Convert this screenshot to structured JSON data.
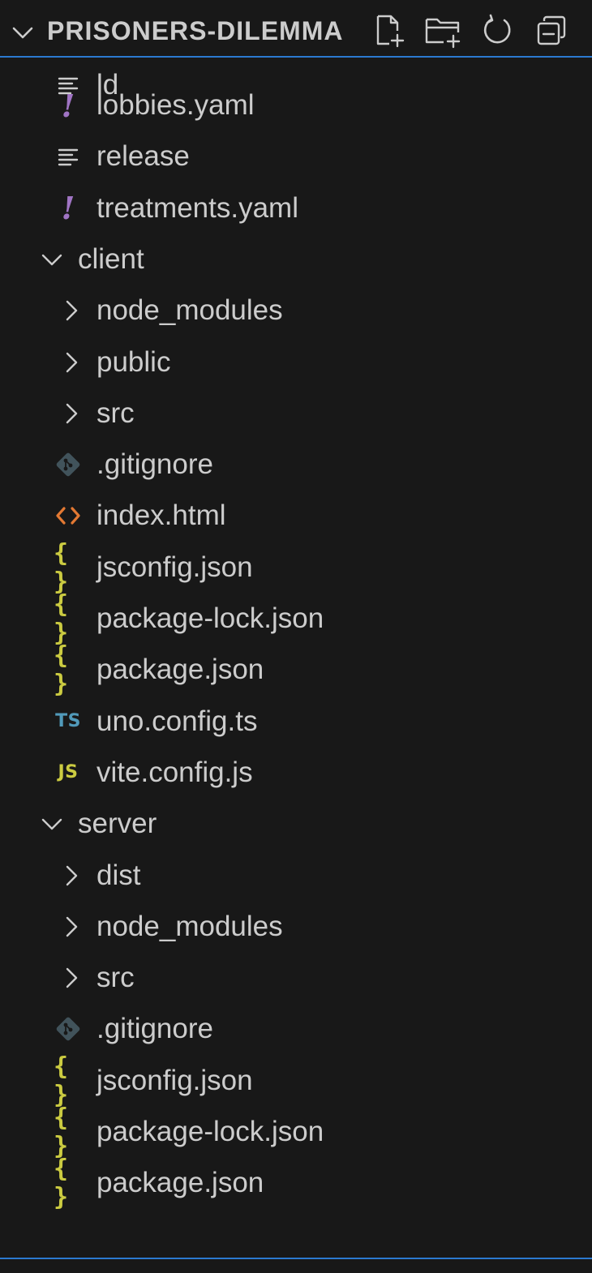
{
  "explorer": {
    "title": "PRISONERS-DILEMMA",
    "actions": [
      {
        "name": "new-file-icon"
      },
      {
        "name": "new-folder-icon"
      },
      {
        "name": "refresh-icon"
      },
      {
        "name": "collapse-all-icon"
      }
    ]
  },
  "tree": [
    {
      "label": "ld",
      "type": "file",
      "icon": "text",
      "depth": 2,
      "row": -0.4
    },
    {
      "label": "lobbies.yaml",
      "type": "file",
      "icon": "yaml",
      "depth": 2,
      "row": 0
    },
    {
      "label": "release",
      "type": "file",
      "icon": "text",
      "depth": 2,
      "row": 1
    },
    {
      "label": "treatments.yaml",
      "type": "file",
      "icon": "yaml",
      "depth": 2,
      "row": 2
    },
    {
      "label": "client",
      "type": "folder",
      "expanded": true,
      "depth": 1,
      "row": 3
    },
    {
      "label": "node_modules",
      "type": "folder",
      "expanded": false,
      "depth": 2,
      "row": 4
    },
    {
      "label": "public",
      "type": "folder",
      "expanded": false,
      "depth": 2,
      "row": 5
    },
    {
      "label": "src",
      "type": "folder",
      "expanded": false,
      "depth": 2,
      "row": 6
    },
    {
      "label": ".gitignore",
      "type": "file",
      "icon": "git",
      "depth": 2,
      "row": 7
    },
    {
      "label": "index.html",
      "type": "file",
      "icon": "html",
      "depth": 2,
      "row": 8
    },
    {
      "label": "jsconfig.json",
      "type": "file",
      "icon": "json",
      "depth": 2,
      "row": 9
    },
    {
      "label": "package-lock.json",
      "type": "file",
      "icon": "json",
      "depth": 2,
      "row": 10
    },
    {
      "label": "package.json",
      "type": "file",
      "icon": "json",
      "depth": 2,
      "row": 11
    },
    {
      "label": "uno.config.ts",
      "type": "file",
      "icon": "ts",
      "depth": 2,
      "row": 12
    },
    {
      "label": "vite.config.js",
      "type": "file",
      "icon": "js",
      "depth": 2,
      "row": 13
    },
    {
      "label": "server",
      "type": "folder",
      "expanded": true,
      "depth": 1,
      "row": 14
    },
    {
      "label": "dist",
      "type": "folder",
      "expanded": false,
      "depth": 2,
      "row": 15
    },
    {
      "label": "node_modules",
      "type": "folder",
      "expanded": false,
      "depth": 2,
      "row": 16
    },
    {
      "label": "src",
      "type": "folder",
      "expanded": false,
      "depth": 2,
      "row": 17
    },
    {
      "label": ".gitignore",
      "type": "file",
      "icon": "git",
      "depth": 2,
      "row": 18
    },
    {
      "label": "jsconfig.json",
      "type": "file",
      "icon": "json",
      "depth": 2,
      "row": 19
    },
    {
      "label": "package-lock.json",
      "type": "file",
      "icon": "json",
      "depth": 2,
      "row": 20
    },
    {
      "label": "package.json",
      "type": "file",
      "icon": "json",
      "depth": 2,
      "row": 21
    }
  ],
  "icon_text": {
    "ts": "TS",
    "js": "JS",
    "json": "{ }",
    "yaml": "!"
  },
  "colors": {
    "background": "#181818",
    "text": "#cccccc",
    "accent_border": "#2b79d0",
    "json": "#cbcb41",
    "js": "#cbcb41",
    "ts": "#519aba",
    "yaml": "#a074c4",
    "html": "#e37933",
    "git": "#41535b"
  }
}
